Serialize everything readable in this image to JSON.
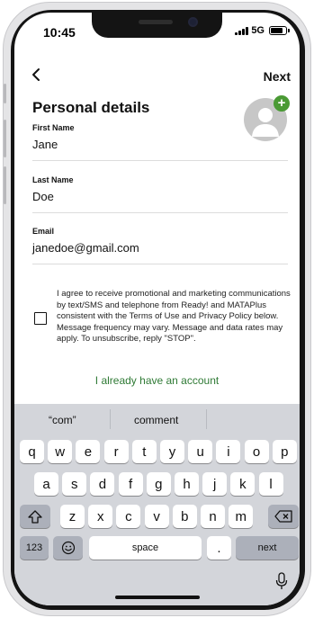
{
  "status_bar": {
    "time": "10:45",
    "network": "5G",
    "signal_bars": 4,
    "battery_level": 0.8
  },
  "nav": {
    "back_icon": "chevron-left-icon",
    "next_label": "Next"
  },
  "page": {
    "title": "Personal details"
  },
  "avatar": {
    "icon": "user-avatar-icon",
    "add_icon": "plus-icon",
    "add_symbol": "+",
    "accent": "#4a9a34"
  },
  "fields": [
    {
      "label": "First Name",
      "value": "Jane"
    },
    {
      "label": "Last Name",
      "value": "Doe"
    },
    {
      "label": "Email",
      "value": "janedoe@gmail.com"
    }
  ],
  "consent": {
    "checked": false,
    "text": "I agree to receive promotional and marketing communications by text/SMS and telephone from Ready! and MATAPlus consistent with the Terms of Use and Privacy Policy below. Message frequency may vary. Message and data rates may apply. To unsubscribe, reply \"STOP\"."
  },
  "account_link": {
    "label": "I already have an account",
    "color": "#2f7a35"
  },
  "keyboard": {
    "suggestions": [
      "“com”",
      "comment",
      ""
    ],
    "row1": [
      "q",
      "w",
      "e",
      "r",
      "t",
      "y",
      "u",
      "i",
      "o",
      "p"
    ],
    "row2": [
      "a",
      "s",
      "d",
      "f",
      "g",
      "h",
      "j",
      "k",
      "l"
    ],
    "row3": [
      "z",
      "x",
      "c",
      "v",
      "b",
      "n",
      "m"
    ],
    "shift_icon": "shift-icon",
    "delete_icon": "backspace-icon",
    "numbers_label": "123",
    "emoji_icon": "emoji-icon",
    "space_label": "space",
    "period_label": ".",
    "return_label": "next",
    "mic_icon": "microphone-icon"
  }
}
